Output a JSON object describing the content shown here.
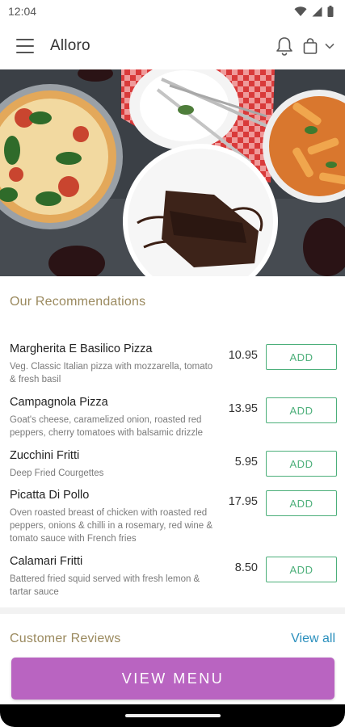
{
  "status_bar": {
    "time": "12:04",
    "icons": [
      "wifi-icon",
      "signal-icon",
      "battery-icon"
    ]
  },
  "app_bar": {
    "title": "Alloro",
    "icons": [
      "hamburger-menu-icon",
      "bell-icon",
      "shopping-bag-icon",
      "chevron-down-icon"
    ]
  },
  "recommendations": {
    "title": "Our Recommendations",
    "items": [
      {
        "name": "Margherita E Basilico Pizza",
        "description": "Veg. Classic Italian pizza with mozzarella, tomato & fresh basil",
        "price": "10.95",
        "action": "ADD"
      },
      {
        "name": "Campagnola Pizza",
        "description": "Goat's cheese, caramelized onion, roasted red peppers, cherry tomatoes with balsamic drizzle",
        "price": "13.95",
        "action": "ADD"
      },
      {
        "name": "Zucchini Fritti",
        "description": "Deep Fried Courgettes",
        "price": "5.95",
        "action": "ADD"
      },
      {
        "name": "Picatta Di Pollo",
        "description": "Oven roasted breast of chicken with roasted red peppers, onions & chilli in a rosemary, red wine & tomato sauce with French fries",
        "price": "17.95",
        "action": "ADD"
      },
      {
        "name": "Calamari Fritti",
        "description": "Battered fried squid served with fresh lemon & tartar sauce",
        "price": "8.50",
        "action": "ADD"
      }
    ]
  },
  "reviews": {
    "title": "Customer Reviews",
    "view_all": "View all"
  },
  "cta": {
    "label": "VIEW MENU"
  },
  "colors": {
    "accent": "#b964c1",
    "add_green": "#4caf7a",
    "section_gold": "#9b8a5f",
    "link_blue": "#2a8fbd"
  }
}
